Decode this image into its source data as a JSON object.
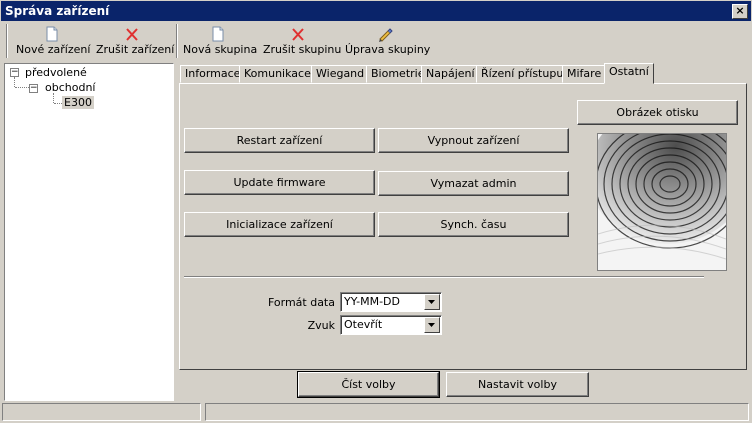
{
  "window": {
    "title": "Správa zařízení",
    "close_label": "×"
  },
  "toolbar": {
    "new_device": "Nové zařízení",
    "delete_device": "Zrušit zařízení",
    "new_group": "Nová skupina",
    "delete_group": "Zrušit skupinu",
    "edit_group": "Úprava skupiny"
  },
  "tree": {
    "root": "předvolené",
    "child": "obchodní",
    "leaf": "E300"
  },
  "tabs": [
    "Informace",
    "Komunikace",
    "Wiegand",
    "Biometrie",
    "Napájení",
    "Řízení přístupu",
    "Mifare",
    "Ostatní"
  ],
  "panel": {
    "restart": "Restart zařízení",
    "power_off": "Vypnout zařízení",
    "update_fw": "Update firmware",
    "clear_admin": "Vymazat admin",
    "init": "Inicializace zařízení",
    "sync_time": "Synch. času",
    "fingerprint_image": "Obrázek otisku",
    "date_format_label": "Formát data",
    "date_format_value": "YY-MM-DD",
    "sound_label": "Zvuk",
    "sound_value": "Otevřít"
  },
  "footer": {
    "read_options": "Číst volby",
    "set_options": "Nastavit volby"
  },
  "colors": {
    "titlebar": "#0a246a",
    "face": "#d4d0c8",
    "delete_x": "#e03030"
  }
}
